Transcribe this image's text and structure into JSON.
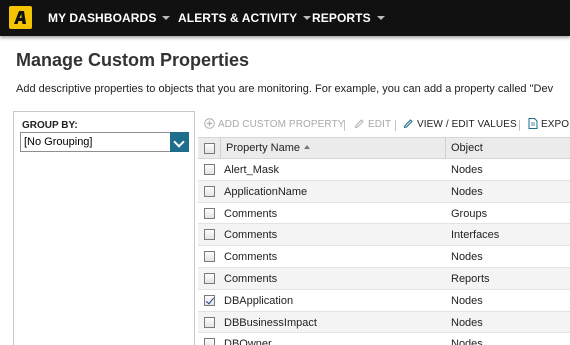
{
  "nav": {
    "items": [
      {
        "label": "MY DASHBOARDS"
      },
      {
        "label": "ALERTS & ACTIVITY"
      },
      {
        "label": "REPORTS"
      }
    ]
  },
  "page": {
    "title": "Manage Custom Properties",
    "description": "Add descriptive properties to objects that you are monitoring. For example, you can add a property called \"Dev"
  },
  "sidebar": {
    "group_label": "GROUP BY:",
    "group_value": "[No Grouping]"
  },
  "toolbar": {
    "add": "ADD CUSTOM PROPERTY",
    "edit": "EDIT",
    "view_edit": "VIEW / EDIT VALUES",
    "export": "EXPO"
  },
  "grid": {
    "columns": [
      "Property Name",
      "Object"
    ],
    "sort": "ascending",
    "rows": [
      {
        "name": "Alert_Mask",
        "object": "Nodes",
        "checked": false
      },
      {
        "name": "ApplicationName",
        "object": "Nodes",
        "checked": false
      },
      {
        "name": "Comments",
        "object": "Groups",
        "checked": false
      },
      {
        "name": "Comments",
        "object": "Interfaces",
        "checked": false
      },
      {
        "name": "Comments",
        "object": "Nodes",
        "checked": false
      },
      {
        "name": "Comments",
        "object": "Reports",
        "checked": false
      },
      {
        "name": "DBApplication",
        "object": "Nodes",
        "checked": true
      },
      {
        "name": "DBBusinessImpact",
        "object": "Nodes",
        "checked": false
      },
      {
        "name": "DBOwner",
        "object": "Nodes",
        "checked": false
      }
    ]
  },
  "colors": {
    "topbar": "#111111",
    "logo": "#f5c400",
    "select_button": "#1f6d8c"
  }
}
